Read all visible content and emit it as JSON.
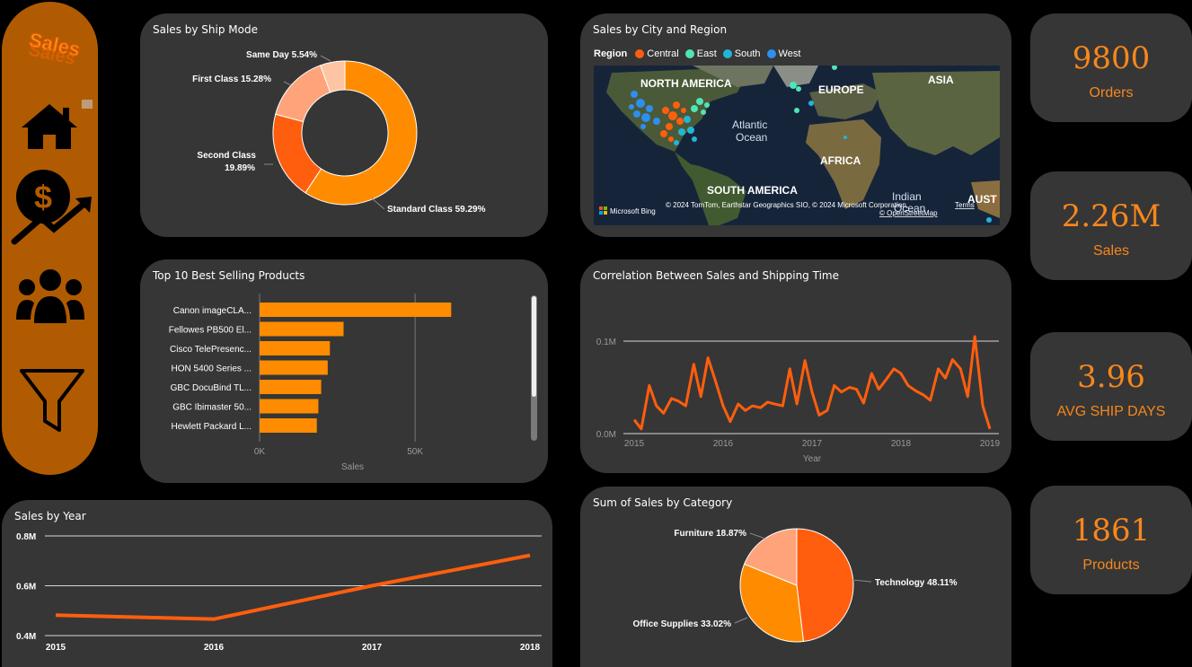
{
  "sidebar": {
    "logo_text": "Sales",
    "nav": [
      {
        "name": "home-icon"
      },
      {
        "name": "sales-growth-icon"
      },
      {
        "name": "customers-icon"
      },
      {
        "name": "filter-icon"
      }
    ]
  },
  "ship_mode": {
    "title": "Sales by Ship Mode",
    "chart_data": {
      "type": "pie",
      "donut": true,
      "slices": [
        {
          "label": "Standard Class",
          "value": 59.29,
          "color": "#ff8c00"
        },
        {
          "label": "Second Class",
          "value": 19.89,
          "color": "#ff5e0e"
        },
        {
          "label": "First Class",
          "value": 15.28,
          "color": "#ffa37a"
        },
        {
          "label": "Same Day",
          "value": 5.54,
          "color": "#ffc4a3"
        }
      ],
      "labels": [
        "Standard Class 59.29%",
        "Second Class",
        "19.89%",
        "First Class 15.28%",
        "Same Day 5.54%"
      ]
    }
  },
  "city_region": {
    "title": "Sales by City and Region",
    "legend_title": "Region",
    "legend": [
      {
        "label": "Central",
        "color": "#ff5e0e"
      },
      {
        "label": "East",
        "color": "#4ee5b7"
      },
      {
        "label": "South",
        "color": "#22b6d6"
      },
      {
        "label": "West",
        "color": "#2d8ff0"
      }
    ],
    "map_labels": {
      "north_america": "NORTH AMERICA",
      "europe": "EUROPE",
      "asia": "ASIA",
      "atlantic": "Atlantic",
      "ocean": "Ocean",
      "africa": "AFRICA",
      "south_america": "SOUTH AMERICA",
      "indian": "Indian",
      "ocean2": "Ocean",
      "aust": "AUST"
    },
    "attribution": "© 2024 TomTom, Earthstar Geographics SIO, © 2024 Microsoft Corporation,",
    "terms": "Terms",
    "osm": "© OpenStreetMap",
    "bing": "Microsoft Bing"
  },
  "kpis": [
    {
      "value": "9800",
      "label": "Orders"
    },
    {
      "value": "2.26M",
      "label": "Sales"
    },
    {
      "value": "3.96",
      "label": "AVG SHIP DAYS"
    },
    {
      "value": "1861",
      "label": "Products"
    }
  ],
  "top_products": {
    "title": "Top 10 Best Selling Products",
    "chart_data": {
      "type": "bar",
      "orientation": "horizontal",
      "categories": [
        "Canon imageCLA...",
        "Fellowes PB500 El...",
        "Cisco TelePresenc...",
        "HON 5400 Series ...",
        "GBC DocuBind TL...",
        "GBC Ibimaster 50...",
        "Hewlett Packard L..."
      ],
      "values": [
        61600,
        27000,
        22600,
        21900,
        19800,
        18900,
        18400
      ],
      "xlim": [
        0,
        80000
      ],
      "ticks": [
        {
          "value": 0,
          "label": "0K"
        },
        {
          "value": 50000,
          "label": "50K"
        }
      ],
      "xlabel": "Sales",
      "color": "#ff8c00"
    }
  },
  "correlation": {
    "title": "Correlation Between Sales and Shipping Time",
    "chart_data": {
      "type": "line",
      "xlabel": "Year",
      "x_ticks": [
        "2015",
        "2016",
        "2017",
        "2018",
        "2019"
      ],
      "y_ticks": [
        {
          "value": 0,
          "label": "0.0M"
        },
        {
          "value": 0.1,
          "label": "0.1M"
        }
      ],
      "ylim": [
        0,
        0.1
      ],
      "xlim": [
        2015,
        2019
      ],
      "color": "#ff5e0e",
      "x": [
        2015.0,
        2015.08,
        2015.17,
        2015.25,
        2015.33,
        2015.42,
        2015.5,
        2015.58,
        2015.67,
        2015.75,
        2015.83,
        2015.92,
        2016.0,
        2016.08,
        2016.17,
        2016.25,
        2016.33,
        2016.42,
        2016.5,
        2016.58,
        2016.67,
        2016.75,
        2016.83,
        2016.92,
        2017.0,
        2017.08,
        2017.17,
        2017.25,
        2017.33,
        2017.42,
        2017.5,
        2017.58,
        2017.67,
        2017.75,
        2017.83,
        2017.92,
        2018.0,
        2018.08,
        2018.17,
        2018.25,
        2018.33,
        2018.42,
        2018.5,
        2018.58,
        2018.67,
        2018.75,
        2018.83,
        2018.92,
        2019.0
      ],
      "y": [
        0.015,
        0.005,
        0.052,
        0.03,
        0.022,
        0.038,
        0.035,
        0.03,
        0.075,
        0.04,
        0.082,
        0.055,
        0.03,
        0.013,
        0.032,
        0.025,
        0.03,
        0.028,
        0.034,
        0.032,
        0.03,
        0.07,
        0.032,
        0.079,
        0.045,
        0.02,
        0.025,
        0.052,
        0.045,
        0.05,
        0.048,
        0.033,
        0.065,
        0.048,
        0.058,
        0.07,
        0.065,
        0.052,
        0.046,
        0.042,
        0.036,
        0.07,
        0.06,
        0.08,
        0.07,
        0.04,
        0.105,
        0.03,
        0.005
      ]
    }
  },
  "sales_year": {
    "title": "Sales by Year",
    "chart_data": {
      "type": "line",
      "x": [
        "2015",
        "2016",
        "2017",
        "2018"
      ],
      "y": [
        0.482,
        0.466,
        0.6,
        0.722
      ],
      "ylim": [
        0.4,
        0.8
      ],
      "y_ticks": [
        {
          "value": 0.4,
          "label": "0.4M"
        },
        {
          "value": 0.6,
          "label": "0.6M"
        },
        {
          "value": 0.8,
          "label": "0.8M"
        }
      ],
      "color": "#ff5e0e"
    }
  },
  "category": {
    "title": "Sum of Sales by Category",
    "chart_data": {
      "type": "pie",
      "slices": [
        {
          "label": "Technology",
          "value": 48.11,
          "color": "#ff5e0e"
        },
        {
          "label": "Office Supplies",
          "value": 33.02,
          "color": "#ff8c00"
        },
        {
          "label": "Furniture",
          "value": 18.87,
          "color": "#ffa37a"
        }
      ],
      "labels": [
        "Technology 48.11%",
        "Office Supplies 33.02%",
        "Furniture 18.87%"
      ]
    }
  }
}
